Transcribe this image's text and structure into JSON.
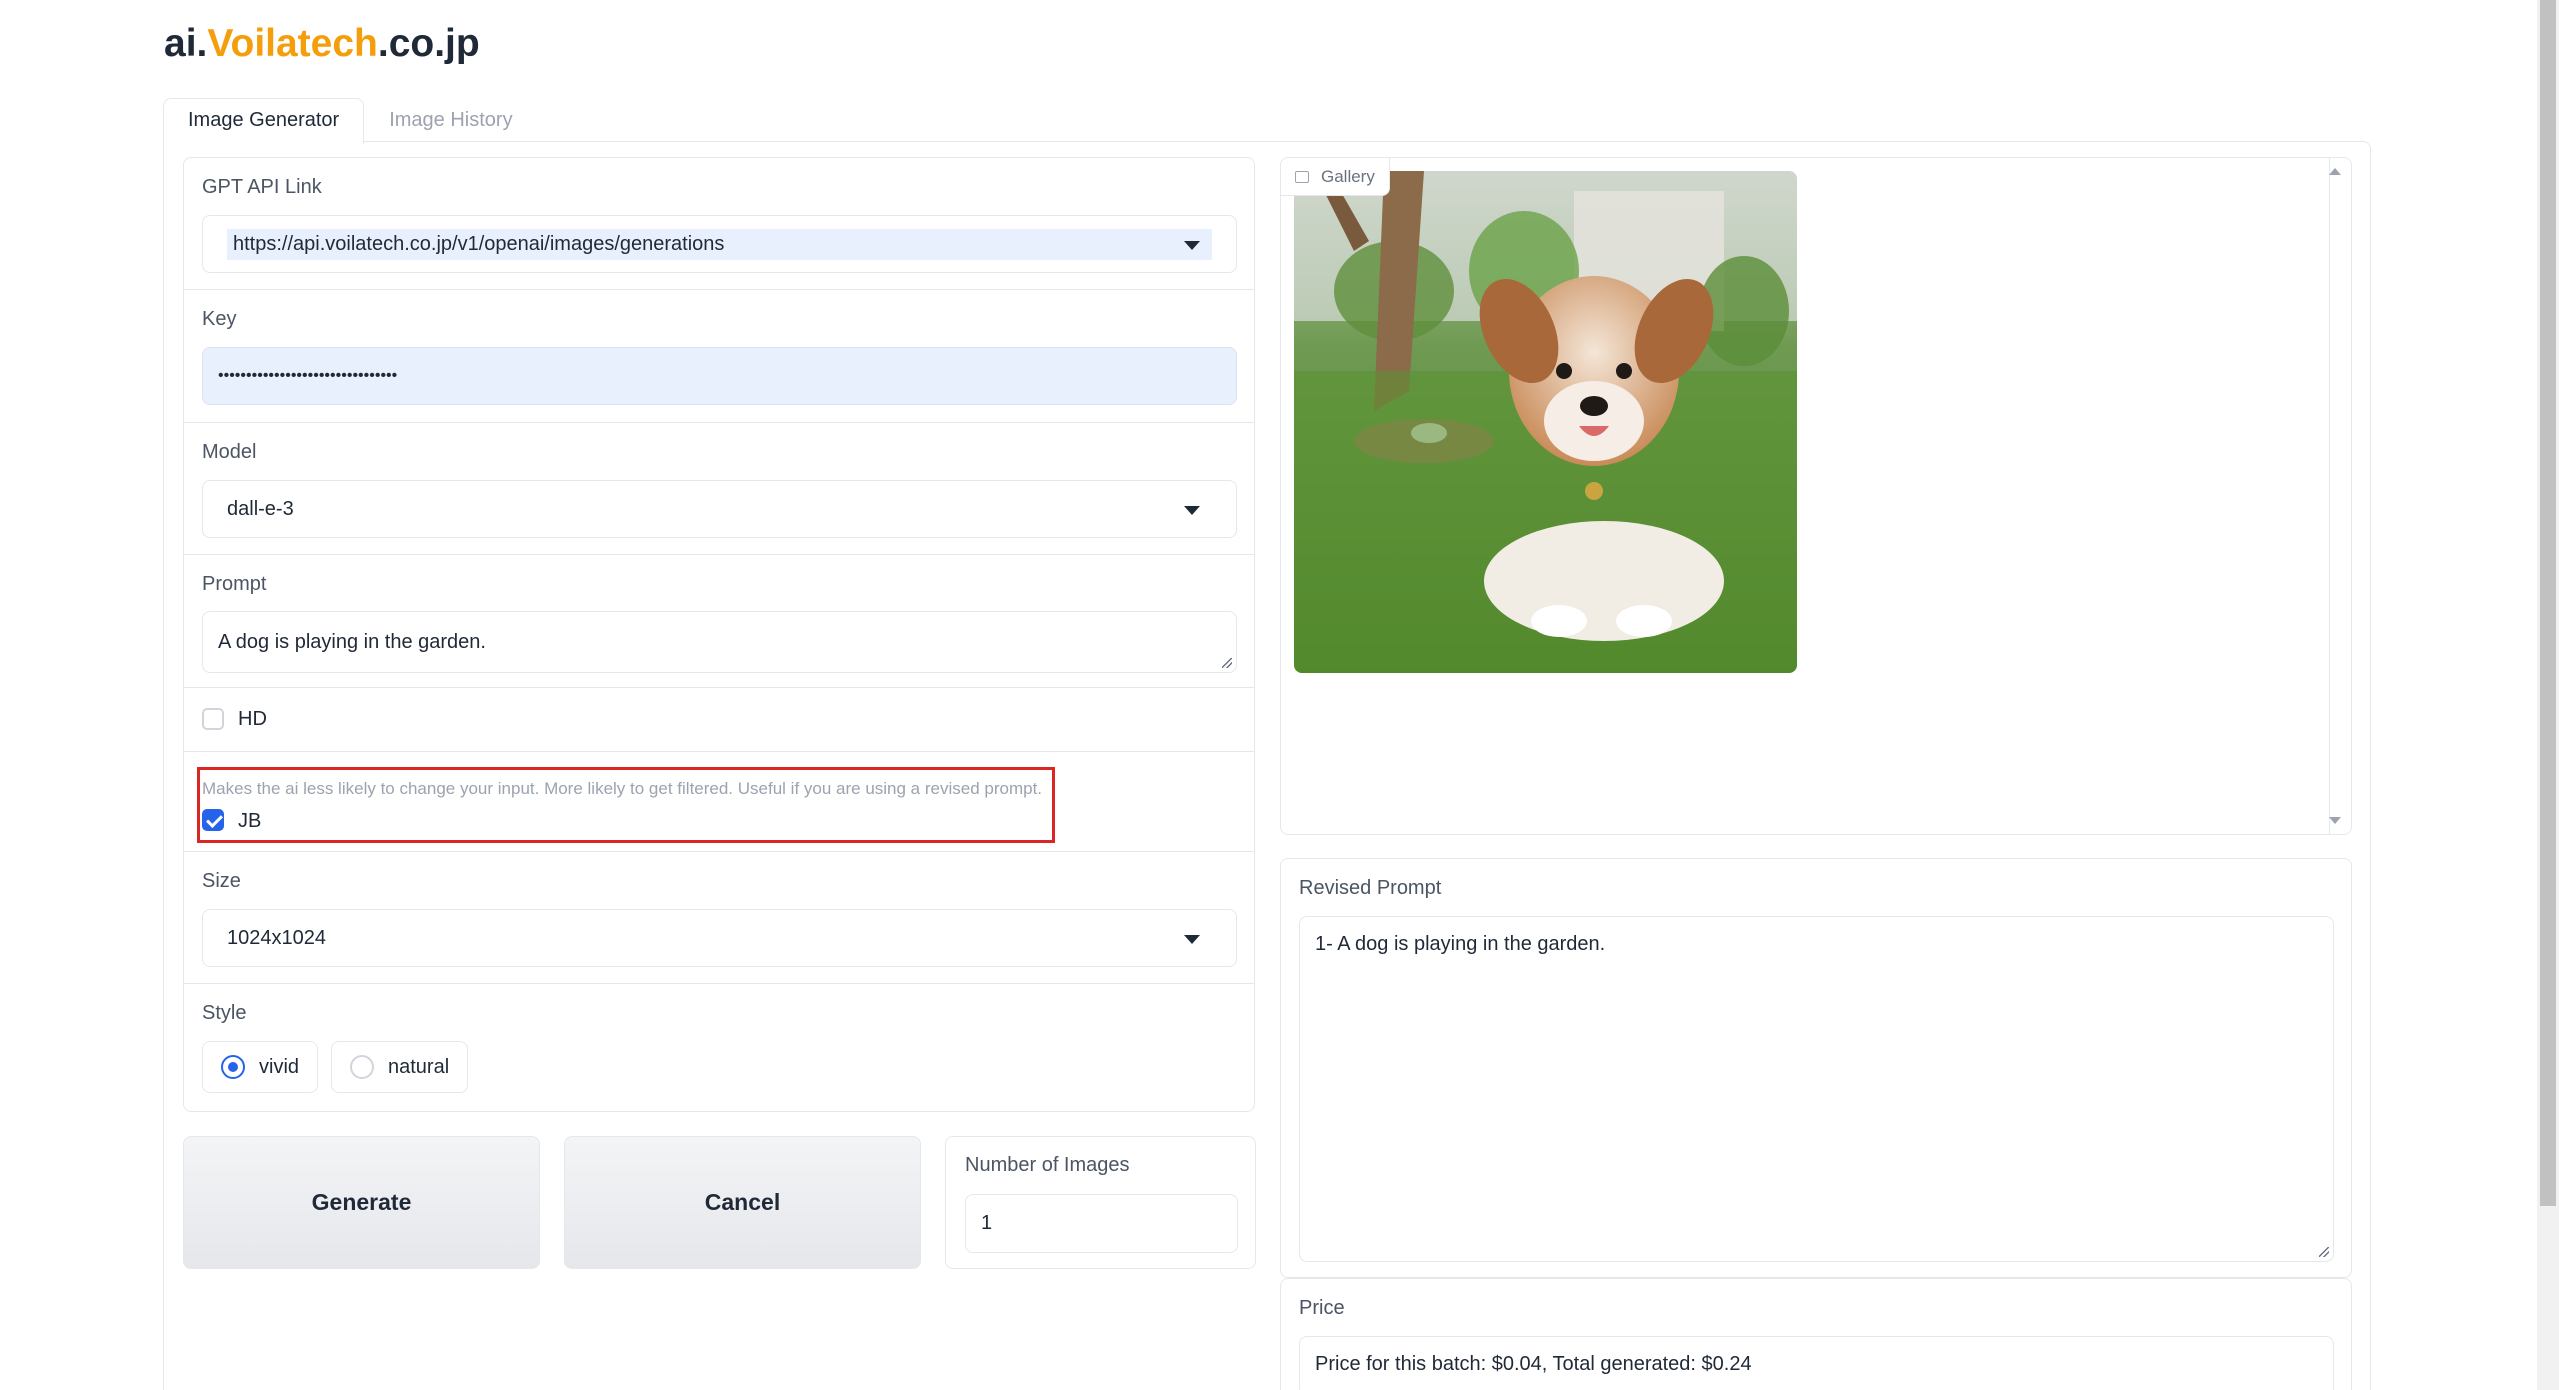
{
  "logo": {
    "prefix": "ai.",
    "brand": "Voilatech",
    "suffix": ".co.jp"
  },
  "tabs": [
    {
      "label": "Image Generator",
      "active": true
    },
    {
      "label": "Image History",
      "active": false
    }
  ],
  "form": {
    "api_link": {
      "label": "GPT API Link",
      "value": "https://api.voilatech.co.jp/v1/openai/images/generations"
    },
    "key": {
      "label": "Key",
      "value": "••••••••••••••••••••••••••••••••"
    },
    "model": {
      "label": "Model",
      "value": "dall-e-3"
    },
    "prompt": {
      "label": "Prompt",
      "value": "A dog is playing in the garden."
    },
    "hd": {
      "label": "HD",
      "checked": false
    },
    "jb": {
      "info": "Makes the ai less likely to change your input. More likely to get filtered. Useful if you are using a revised prompt.",
      "label": "JB",
      "checked": true
    },
    "size": {
      "label": "Size",
      "value": "1024x1024"
    },
    "style": {
      "label": "Style",
      "options": [
        "vivid",
        "natural"
      ],
      "selected": "vivid"
    }
  },
  "actions": {
    "generate": "Generate",
    "cancel": "Cancel",
    "num_images": {
      "label": "Number of Images",
      "value": "1"
    }
  },
  "gallery": {
    "label": "Gallery",
    "image_alt": "puppy-in-garden"
  },
  "revised_prompt": {
    "label": "Revised Prompt",
    "value": "1- A dog is playing in the garden."
  },
  "price": {
    "label": "Price",
    "value": "Price for this batch: $0.04, Total generated: $0.24"
  },
  "colors": {
    "accent": "#f59e0b",
    "primary": "#2563eb",
    "highlight_border": "#dc2626"
  }
}
